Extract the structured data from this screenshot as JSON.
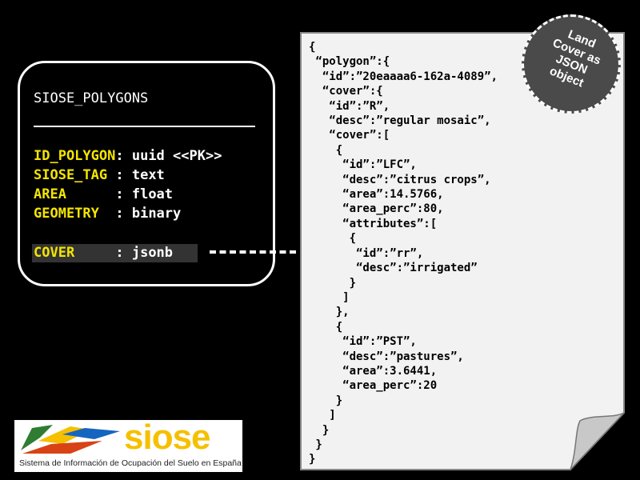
{
  "table": {
    "title": "SIOSE_POLYGONS",
    "fields": [
      {
        "name": "ID_POLYGON",
        "sep": ": ",
        "type": "uuid <<PK>>"
      },
      {
        "name": "SIOSE_TAG ",
        "sep": ": ",
        "type": "text"
      },
      {
        "name": "AREA      ",
        "sep": ": ",
        "type": "float"
      },
      {
        "name": "GEOMETRY  ",
        "sep": ": ",
        "type": "binary"
      },
      {
        "name": "COVER     ",
        "sep": ": ",
        "type": "jsonb"
      }
    ]
  },
  "json_document": {
    "lines": [
      "{",
      " “polygon”:{",
      "  “id”:”20eaaaa6-162a-4089”,",
      "  “cover”:{",
      "   “id”:”R”,",
      "   “desc”:”regular mosaic”,",
      "   “cover”:[",
      "    {",
      "     “id”:”LFC”,",
      "     “desc”:”citrus crops”,",
      "     “area”:14.5766,",
      "     “area_perc”:80,",
      "     “attributes”:[",
      "      {",
      "       “id”:”rr”,",
      "       “desc”:”irrigated”",
      "      }",
      "     ]",
      "    },",
      "    {",
      "     “id”:”PST”,",
      "     “desc”:”pastures”,",
      "     “area”:3.6441,",
      "     “area_perc”:20",
      "    }",
      "   ]",
      "  }",
      " }",
      "}"
    ]
  },
  "badge": {
    "lines": [
      "Land",
      "Cover as",
      "JSON",
      "object"
    ]
  },
  "logo": {
    "word": "siose",
    "subtitle": "Sistema de Información de Ocupación del Suelo en España"
  },
  "colors": {
    "background": "#000000",
    "field_name": "#f4e500",
    "text": "#ffffff",
    "paper": "#f2f2f2",
    "badge": "#4a4a4a",
    "logo_yellow": "#f5c000"
  }
}
